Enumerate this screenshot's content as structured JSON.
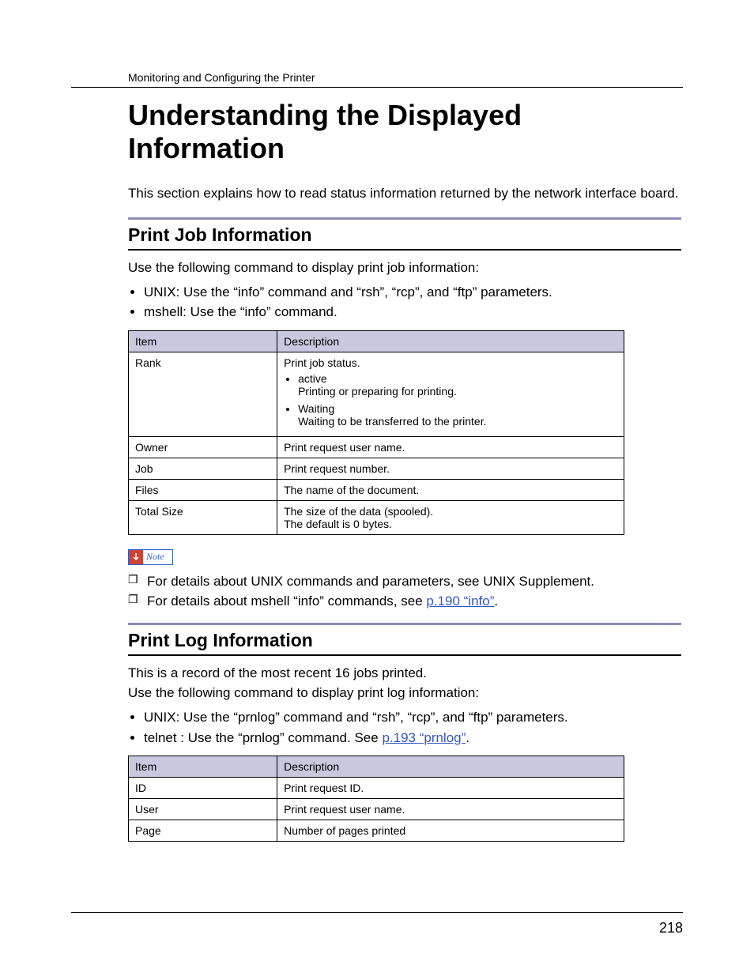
{
  "runningHeader": "Monitoring and Configuring the Printer",
  "title": "Understanding the Displayed Information",
  "intro": "This section explains how to read status information returned by the network interface board.",
  "section1": {
    "heading": "Print Job Information",
    "lead": "Use the following command to display print job information:",
    "bullets": [
      "UNIX: Use the “info” command and “rsh”, “rcp”, and “ftp” parameters.",
      "mshell: Use the “info” command."
    ],
    "table": {
      "headers": [
        "Item",
        "Description"
      ],
      "rows": [
        {
          "item": "Rank",
          "descIntro": "Print job status.",
          "descList": [
            {
              "t": "active",
              "d": "Printing or preparing for printing."
            },
            {
              "t": "Waiting",
              "d": "Waiting to be transferred to the printer."
            }
          ]
        },
        {
          "item": "Owner",
          "desc": "Print request user name."
        },
        {
          "item": "Job",
          "desc": "Print request number."
        },
        {
          "item": "Files",
          "desc": "The name of the document."
        },
        {
          "item": "Total Size",
          "descLines": [
            "The size of the data (spooled).",
            "The default is 0 bytes."
          ]
        }
      ]
    },
    "noteLabel": "Note",
    "notes": [
      {
        "pre": "For details about UNIX commands and parameters, see UNIX Supplement."
      },
      {
        "pre": "For details about mshell “info” commands, see ",
        "link": "p.190 “info”",
        "post": "."
      }
    ]
  },
  "section2": {
    "heading": "Print Log Information",
    "para1": "This is a record of the most recent 16 jobs printed.",
    "para2": "Use the following command to display print log information:",
    "bullets": [
      {
        "text": "UNIX: Use the “prnlog” command and “rsh”, “rcp”, and “ftp” parameters."
      },
      {
        "pre": "telnet : Use the “prnlog” command. See ",
        "link": "p.193 “prnlog”",
        "post": "."
      }
    ],
    "table": {
      "headers": [
        "Item",
        "Description"
      ],
      "rows": [
        {
          "item": "ID",
          "desc": "Print request ID."
        },
        {
          "item": "User",
          "desc": "Print request user name."
        },
        {
          "item": "Page",
          "desc": "Number of pages printed"
        }
      ]
    }
  },
  "pageNumber": "218"
}
